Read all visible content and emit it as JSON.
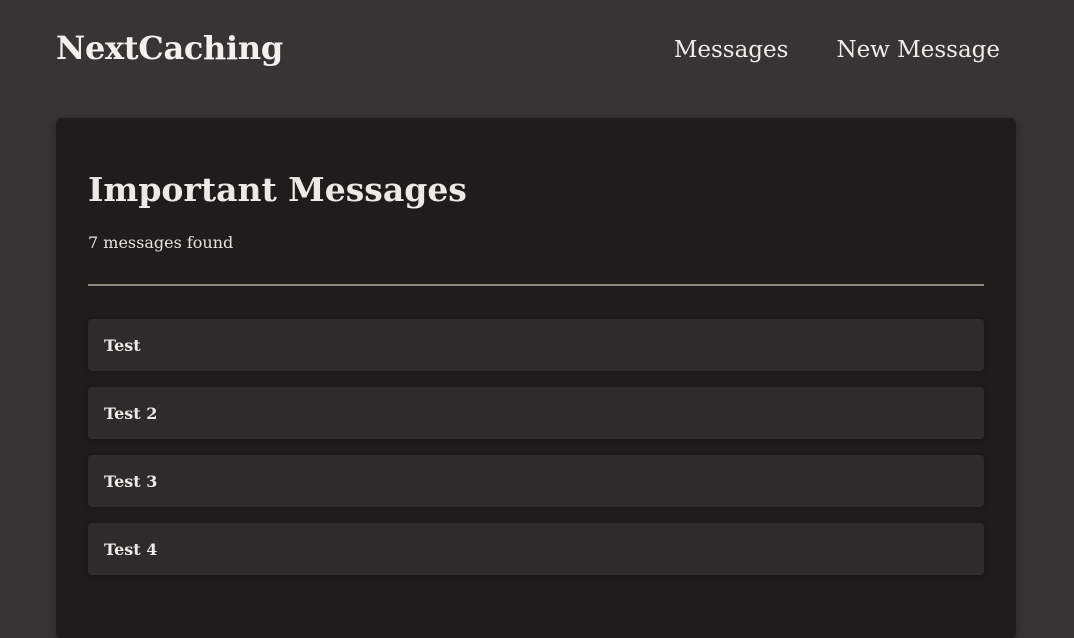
{
  "header": {
    "logo": "NextCaching",
    "nav": [
      {
        "label": "Messages"
      },
      {
        "label": "New Message"
      }
    ]
  },
  "main": {
    "title": "Important Messages",
    "count_text": "7 messages found",
    "messages": [
      {
        "title": "Test"
      },
      {
        "title": "Test 2"
      },
      {
        "title": "Test 3"
      },
      {
        "title": "Test 4"
      }
    ]
  }
}
